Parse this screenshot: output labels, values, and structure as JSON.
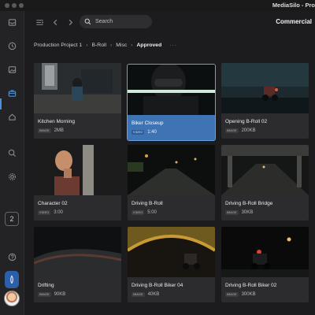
{
  "window": {
    "title": "MediaSilo - Pro"
  },
  "sidebar": {
    "icons": [
      "inbox-icon",
      "clock-icon",
      "image-icon",
      "briefcase-icon",
      "home-icon",
      "search-icon",
      "gear-icon",
      "help-icon"
    ],
    "badge": "2",
    "active_color": "#4a90d9"
  },
  "toolbar": {
    "search_label": "Search",
    "project": "Commercial"
  },
  "breadcrumb": {
    "items": [
      "Production Project 1",
      "B-Roll",
      "Misc"
    ],
    "current": "Approved",
    "more": "···"
  },
  "cards": [
    {
      "title": "Kitchen Morning",
      "type": "IMAGE",
      "meta": "2MB"
    },
    {
      "title": "Biker Closeup",
      "type": "VIDEO",
      "meta": "1:40",
      "selected": true
    },
    {
      "title": "Opening B-Roll 02",
      "type": "IMAGE",
      "meta": "200KB"
    },
    {
      "title": "Character 02",
      "type": "VIDEO",
      "meta": "3:00"
    },
    {
      "title": "Driving B-Roll",
      "type": "VIDEO",
      "meta": "5:00"
    },
    {
      "title": "Driving B-Roll Bridge",
      "type": "IMAGE",
      "meta": "30KB"
    },
    {
      "title": "Drifting",
      "type": "IMAGE",
      "meta": "90KB"
    },
    {
      "title": "Driving B-Roll Biker 04",
      "type": "IMAGE",
      "meta": "40KB"
    },
    {
      "title": "Driving B-Roll Biker 02",
      "type": "IMAGE",
      "meta": "300KB"
    }
  ]
}
